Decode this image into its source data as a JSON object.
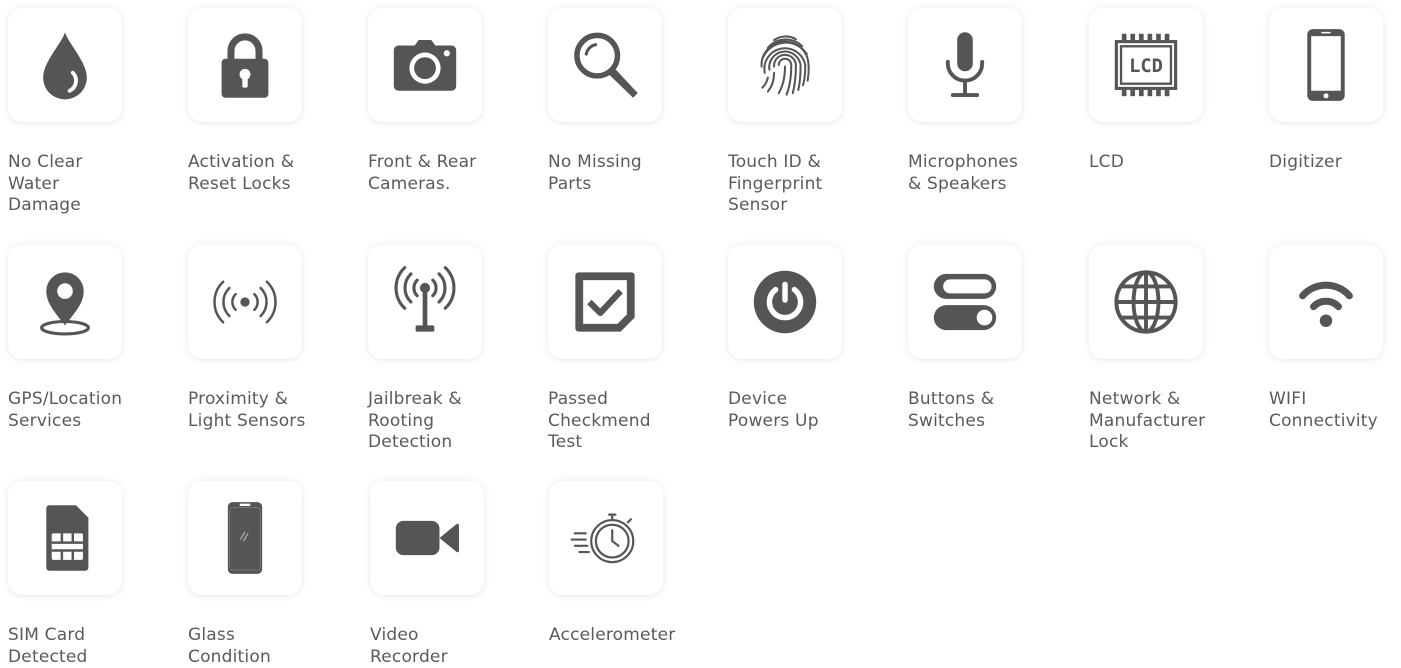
{
  "colors": {
    "icon": "#555555",
    "text": "#5a5a5a",
    "tile": "#ffffff"
  },
  "items": [
    {
      "icon": "water-drop-icon",
      "label": "No Clear\nWater\nDamage"
    },
    {
      "icon": "padlock-icon",
      "label": "Activation &\nReset Locks"
    },
    {
      "icon": "camera-icon",
      "label": "Front & Rear\nCameras."
    },
    {
      "icon": "magnifier-icon",
      "label": "No Missing\nParts"
    },
    {
      "icon": "fingerprint-icon",
      "label": "Touch ID &\nFingerprint\nSensor"
    },
    {
      "icon": "microphone-icon",
      "label": "Microphones\n& Speakers"
    },
    {
      "icon": "lcd-chip-icon",
      "icon_text": "LCD",
      "label": "LCD"
    },
    {
      "icon": "smartphone-icon",
      "label": "Digitizer"
    },
    {
      "icon": "location-pin-icon",
      "label": "GPS/Location\nServices"
    },
    {
      "icon": "proximity-signal-icon",
      "label": "Proximity &\nLight Sensors"
    },
    {
      "icon": "antenna-icon",
      "label": "Jailbreak &\nRooting\nDetection"
    },
    {
      "icon": "checkbox-icon",
      "label": "Passed\nCheckmend\nTest"
    },
    {
      "icon": "power-icon",
      "label": "Device\nPowers Up"
    },
    {
      "icon": "toggle-switches-icon",
      "label": "Buttons &\nSwitches"
    },
    {
      "icon": "globe-icon",
      "label": "Network &\nManufacturer\nLock"
    },
    {
      "icon": "wifi-icon",
      "label": "WIFI\nConnectivity"
    },
    {
      "icon": "sim-card-icon",
      "label": "SIM Card\nDetected"
    },
    {
      "icon": "phone-glass-icon",
      "label": "Glass\nCondition"
    },
    {
      "icon": "video-camera-icon",
      "label": "Video\nRecorder"
    },
    {
      "icon": "stopwatch-icon",
      "label": "Accelerometer"
    }
  ]
}
